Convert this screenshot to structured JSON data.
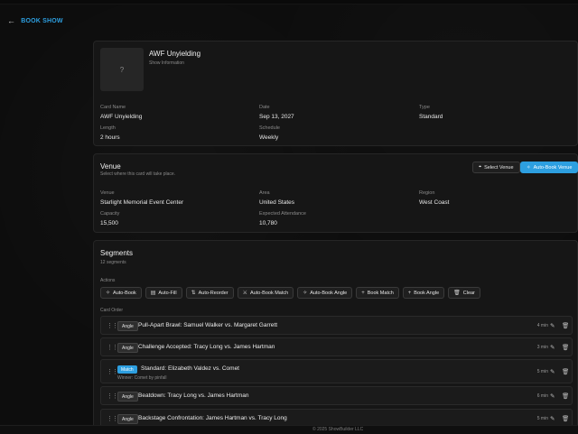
{
  "nav": {
    "back_arrow": "←",
    "back_label": "BOOK SHOW"
  },
  "show": {
    "thumb_placeholder": "?",
    "title": "AWF Unyielding",
    "subtitle": "Show Information",
    "fields": [
      {
        "label": "Card Name",
        "value": "AWF Unyielding"
      },
      {
        "label": "Date",
        "value": "Sep 13, 2027"
      },
      {
        "label": "Type",
        "value": "Standard"
      },
      {
        "label": "Length",
        "value": "2 hours"
      },
      {
        "label": "Schedule",
        "value": "Weekly"
      }
    ]
  },
  "venue": {
    "title": "Venue",
    "subtitle": "Select where this card will take place.",
    "select_button": "Select Venue",
    "autobook_button": "Auto-Book Venue",
    "fields": [
      {
        "label": "Venue",
        "value": "Starlight Memorial Event Center"
      },
      {
        "label": "Area",
        "value": "United States"
      },
      {
        "label": "Region",
        "value": "West Coast"
      },
      {
        "label": "Capacity",
        "value": "15,500"
      },
      {
        "label": "Expected Attendance",
        "value": "10,780"
      }
    ]
  },
  "segments": {
    "title": "Segments",
    "count": "12 segments",
    "actions_label": "Actions",
    "card_order_label": "Card Order",
    "actions": [
      {
        "icon": "✧",
        "label": "Auto-Book"
      },
      {
        "icon": "▤",
        "label": "Auto-Fill"
      },
      {
        "icon": "⇅",
        "label": "Auto-Reorder"
      },
      {
        "icon": "⚔",
        "label": "Auto-Book Match"
      },
      {
        "icon": "✧",
        "label": "Auto-Book Angle"
      },
      {
        "icon": "+",
        "label": "Book Match"
      },
      {
        "icon": "+",
        "label": "Book Angle"
      },
      {
        "icon": "🗑",
        "label": "Clear"
      }
    ],
    "items": [
      {
        "tag": "Angle",
        "title": "Pull-Apart Brawl: Samuel Walker vs. Margaret Garrett",
        "note": "",
        "duration": "4 min"
      },
      {
        "tag": "Angle",
        "title": "Challenge Accepted: Tracy Long vs. James Hartman",
        "note": "",
        "duration": "3 min"
      },
      {
        "tag": "Match",
        "title": "Standard: Elizabeth Valdez vs. Comet",
        "note": "Winner: Comet by pinfall",
        "duration": "5 min"
      },
      {
        "tag": "Angle",
        "title": "Beatdown: Tracy Long vs. James Hartman",
        "note": "",
        "duration": "6 min"
      },
      {
        "tag": "Angle",
        "title": "Backstage Confrontation: James Hartman vs. Tracy Long",
        "note": "",
        "duration": "5 min"
      }
    ]
  },
  "footer": {
    "text": "© 2025 ShowBuilder LLC"
  },
  "colors": {
    "accent": "#2d9fe0",
    "background": "#0d0d0d",
    "card": "#161616"
  }
}
